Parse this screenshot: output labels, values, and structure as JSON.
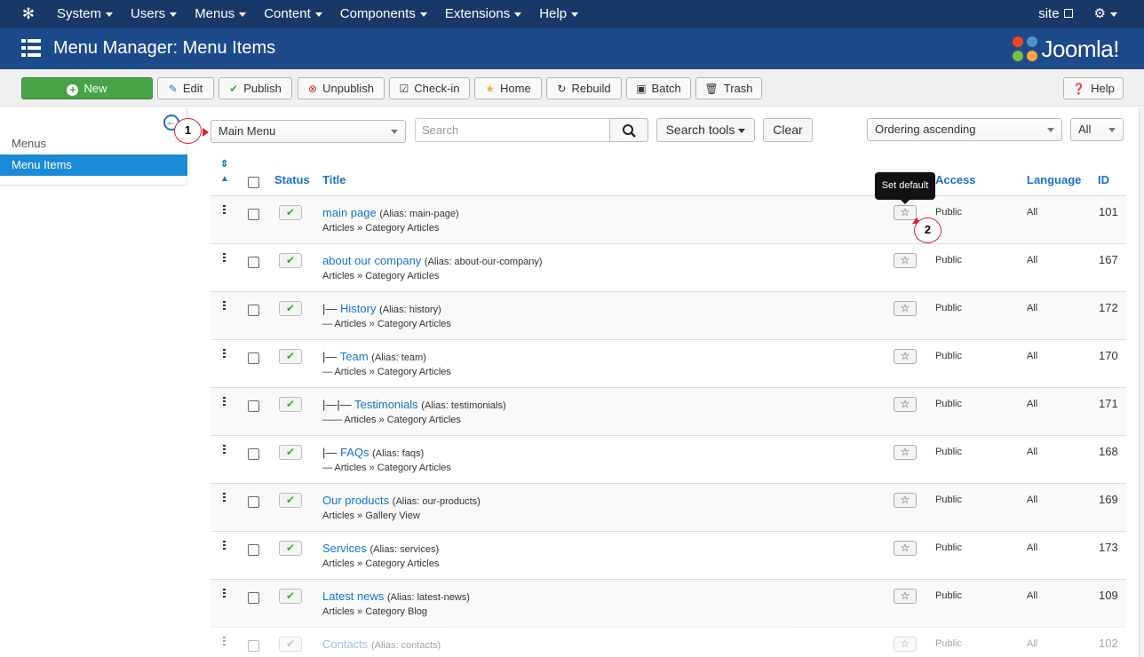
{
  "navbar": {
    "logo_icon": "joomla-logo-icon",
    "menu": [
      "System",
      "Users",
      "Menus",
      "Content",
      "Components",
      "Extensions",
      "Help"
    ],
    "site_label": "site",
    "settings_icon": "gear-icon"
  },
  "header": {
    "title": "Menu Manager: Menu Items",
    "brand": "Joomla!"
  },
  "toolbar": {
    "new": "New",
    "edit": "Edit",
    "publish": "Publish",
    "unpublish": "Unpublish",
    "checkin": "Check-in",
    "home": "Home",
    "rebuild": "Rebuild",
    "batch": "Batch",
    "trash": "Trash",
    "help": "Help"
  },
  "sidebar": {
    "items": [
      {
        "label": "Menus",
        "active": false
      },
      {
        "label": "Menu Items",
        "active": true
      }
    ]
  },
  "filters": {
    "menu_select": "Main Menu",
    "search_placeholder": "Search",
    "search_tools": "Search tools",
    "clear": "Clear",
    "ordering": "Ordering ascending",
    "limit": "All"
  },
  "callouts": {
    "first": "1",
    "second": "2"
  },
  "table": {
    "headers": {
      "status": "Status",
      "title": "Title",
      "access": "Access",
      "language": "Language",
      "id": "ID"
    },
    "tooltip": "Set default",
    "rows": [
      {
        "prefix": "",
        "title": "main page",
        "alias": "(Alias: main-page)",
        "type": "Articles » Category Articles",
        "access": "Public",
        "language": "All",
        "id": "101"
      },
      {
        "prefix": "",
        "title": "about our company",
        "alias": "(Alias: about-our-company)",
        "type": "Articles » Category Articles",
        "access": "Public",
        "language": "All",
        "id": "167"
      },
      {
        "prefix": "|— ",
        "title": "History",
        "alias": "(Alias: history)",
        "type": "— Articles » Category Articles",
        "access": "Public",
        "language": "All",
        "id": "172"
      },
      {
        "prefix": "|— ",
        "title": "Team",
        "alias": "(Alias: team)",
        "type": "— Articles » Category Articles",
        "access": "Public",
        "language": "All",
        "id": "170"
      },
      {
        "prefix": "|—|— ",
        "title": "Testimonials",
        "alias": "(Alias: testimonials)",
        "type": "—— Articles » Category Articles",
        "access": "Public",
        "language": "All",
        "id": "171"
      },
      {
        "prefix": "|— ",
        "title": "FAQs",
        "alias": "(Alias: faqs)",
        "type": "— Articles » Category Articles",
        "access": "Public",
        "language": "All",
        "id": "168"
      },
      {
        "prefix": "",
        "title": "Our products",
        "alias": "(Alias: our-products)",
        "type": "Articles » Gallery View",
        "access": "Public",
        "language": "All",
        "id": "169"
      },
      {
        "prefix": "",
        "title": "Services",
        "alias": "(Alias: services)",
        "type": "Articles » Category Articles",
        "access": "Public",
        "language": "All",
        "id": "173"
      },
      {
        "prefix": "",
        "title": "Latest news",
        "alias": "(Alias: latest-news)",
        "type": "Articles » Category Blog",
        "access": "Public",
        "language": "All",
        "id": "109"
      },
      {
        "prefix": "",
        "title": "Contacts",
        "alias": "(Alias: contacts)",
        "type": "",
        "access": "Public",
        "language": "All",
        "id": "102"
      }
    ]
  },
  "colors": {
    "navbar": "#1a3867",
    "header": "#1d4a8a",
    "link": "#1a73c7",
    "new_button": "#48a348",
    "active_side": "#1a8bd6",
    "callout_border": "#d2232a"
  }
}
